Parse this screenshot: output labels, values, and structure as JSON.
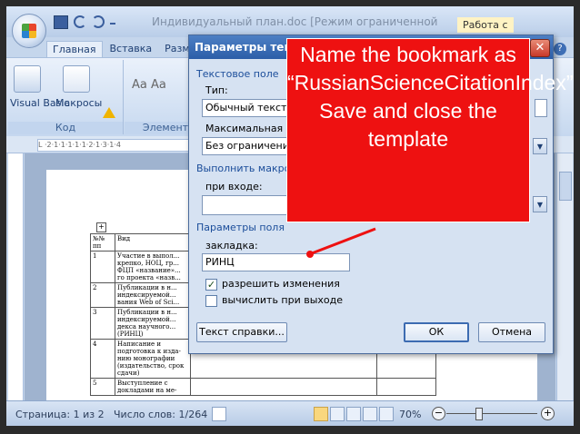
{
  "window": {
    "title": "Индивидуальный план.doc [Режим ограниченной",
    "context_tab": "Работа с"
  },
  "ribbon": {
    "tabs": [
      "Главная",
      "Вставка",
      "Размет"
    ],
    "groups": {
      "code": {
        "label": "Код",
        "visual_basic": "Visual Basic",
        "macros": "Макросы"
      },
      "elements": {
        "label": "Элемент"
      }
    }
  },
  "ruler": {
    "text": "L ·2·1·1·1·1·1·2·1·3·1·4"
  },
  "document": {
    "table_rows": [
      {
        "num": "№№ пп",
        "text": "Вид"
      },
      {
        "num": "1",
        "text": "Участие в выпол... крепко, НОЦ, гр... ФЦП «название»... го проекта «назв..."
      },
      {
        "num": "2",
        "text": "Публикации в н... индексируемой... вания Web of Sci..."
      },
      {
        "num": "3",
        "text": "Публикации в н... индексируемой... декса научного... (РИНЦ)"
      },
      {
        "num": "4",
        "text": "Написание и подготовка к изда- нию монографии (издательство, срок сдачи)"
      },
      {
        "num": "5",
        "text": "Выступление с докладами на ме-"
      }
    ]
  },
  "status_bar": {
    "page": "Страница: 1 из 2",
    "words": "Число слов: 1/264",
    "zoom": "70%",
    "zoom_minus": "−",
    "zoom_plus": "+"
  },
  "dialog": {
    "title": "Параметры текст",
    "close": "✕",
    "text_field_section": "Текстовое поле",
    "type_label": "Тип:",
    "type_value": "Обычный текст",
    "maxlen_label": "Максимальная дли",
    "maxlen_value": "Без ограничени",
    "run_macro_section": "Выполнить макрос",
    "on_entry_label": "при входе:",
    "on_entry_value": "",
    "field_params_section": "Параметры поля",
    "bookmark_label": "закладка:",
    "bookmark_value": "РИНЦ",
    "allow_changes": {
      "label": "разрешить изменения",
      "checked": true
    },
    "calc_on_exit": {
      "label": "вычислить при выходе",
      "checked": false
    },
    "help_text_button": "Текст справки...",
    "ok_button": "ОК",
    "cancel_button": "Отмена"
  },
  "callout": {
    "text": "Name the bookmark as “RussianScienceCitationIndex”. Save and close the template",
    "color": "#ee1111"
  }
}
